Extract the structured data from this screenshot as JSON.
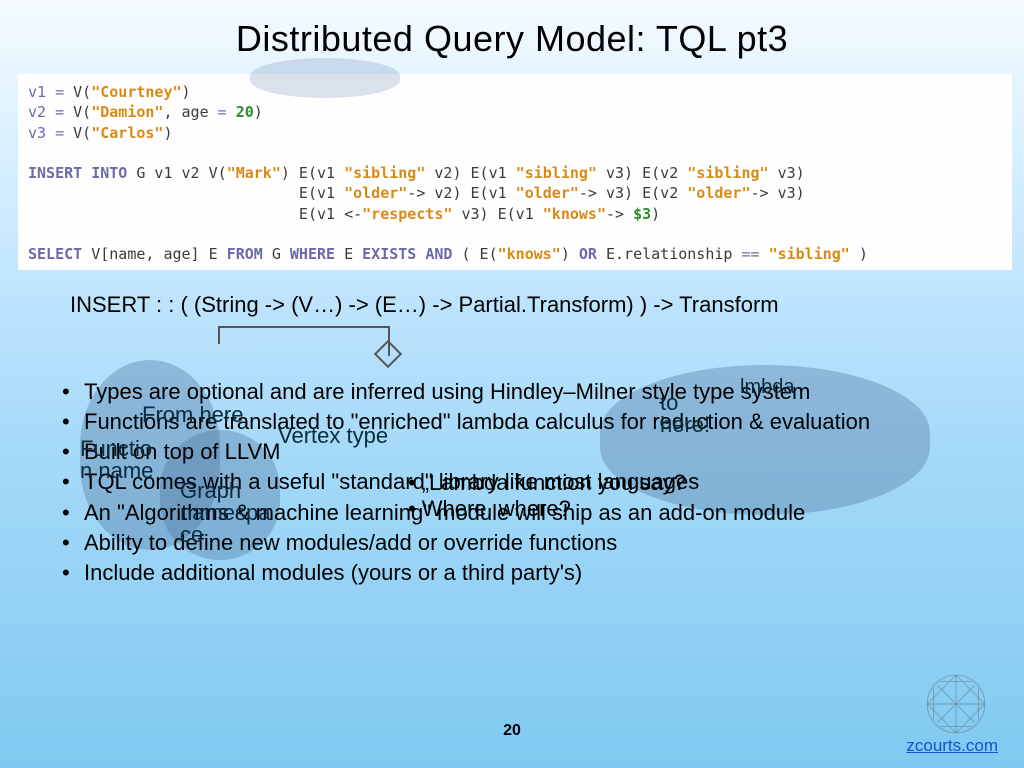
{
  "title": "Distributed Query Model: TQL pt3",
  "code_lines_plain": [
    "v1 = V(\"Courtney\")",
    "v2 = V(\"Damion\", age = 20)",
    "v3 = V(\"Carlos\")",
    "",
    "INSERT INTO G v1 v2 V(\"Mark\") E(v1 \"sibling\" v2) E(v1 \"sibling\" v3) E(v2 \"sibling\" v3)",
    "                              E(v1 \"older\"-> v2) E(v1 \"older\"-> v3) E(v2 \"older\"-> v3)",
    "                              E(v1 <-\"respects\" v3) E(v1 \"knows\"-> $3)",
    "",
    "SELECT V[name, age] E FROM G WHERE E EXISTS AND ( E(\"knows\") OR E.relationship == \"sibling\" )"
  ],
  "signature": "INSERT : : ( (String -> (V…) -> (E…) -> Partial.Transform) ) -> Transform",
  "bullets": [
    "Types are optional and are inferred using Hindley–Milner style type system",
    "Functions are translated to \"enriched\" lambda calculus for reduction & evaluation",
    "Built on top of LLVM",
    "TQL comes with a useful \"standard\" library like most languages",
    "An \"Algorithms & machine learning\" module will ship as an add-on module",
    "Ability to define new modules/add or override functions",
    "Include additional modules (yours or a third party's)"
  ],
  "ghost_fragments": {
    "from_here": "From here",
    "functio_n_name": "Function name",
    "vertex_type": "Vertex type",
    "graph_namespace": "Graph namespace",
    "to_here": "to here!",
    "lambda_top": "lmbda",
    "inner1": "„Lambda function you say?",
    "inner2": "Where, where?"
  },
  "page_number": "20",
  "footer": "zcourts.com"
}
